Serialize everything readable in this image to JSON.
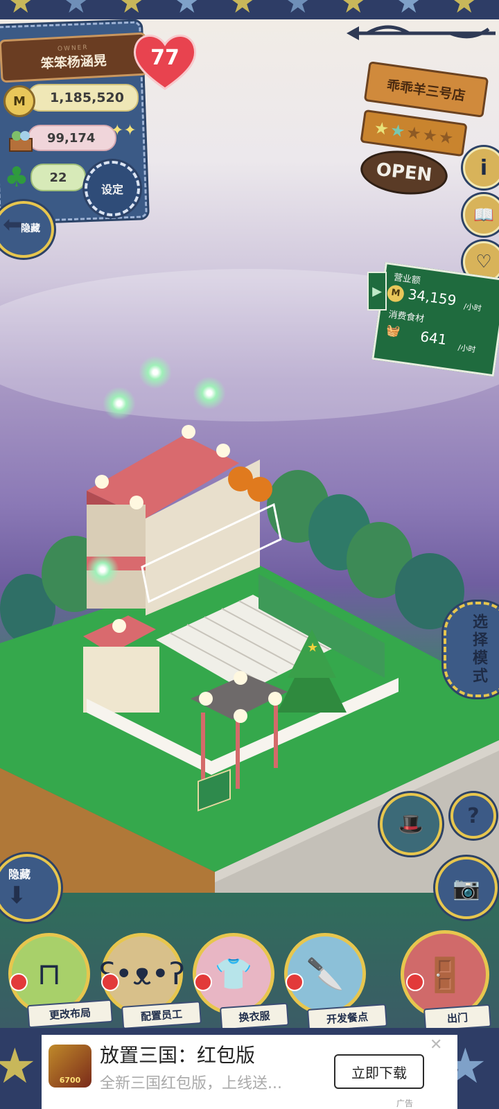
{
  "owner": {
    "badge": "OWNER",
    "name": "笨笨杨涵晃",
    "level": "77"
  },
  "stats": {
    "money": "1,185,520",
    "ingredients": "99,174",
    "clover": "22"
  },
  "buttons": {
    "settings": "设定",
    "hide_top": "隐藏",
    "hide_bottom": "隐藏",
    "select_mode": "选择模式"
  },
  "shop": {
    "name": "乖乖羊三号店",
    "stars_filled": 2,
    "stars_total": 5,
    "open_sign": "OPEN"
  },
  "revenue_panel": {
    "revenue_label": "营业额",
    "revenue_value": "34,159",
    "revenue_unit": "/小时",
    "consume_label": "消费食材",
    "consume_value": "641",
    "consume_unit": "/小时"
  },
  "side_icons": [
    "info-icon",
    "book-icon",
    "heart-icon"
  ],
  "menu": [
    {
      "label": "更改布局",
      "icon": "table-icon"
    },
    {
      "label": "配置员工",
      "icon": "bear-icon"
    },
    {
      "label": "换衣服",
      "icon": "shirt-icon"
    },
    {
      "label": "开发餐点",
      "icon": "knife-icon"
    },
    {
      "label": "出门",
      "icon": "door-icon"
    }
  ],
  "ad": {
    "title": "放置三国：红包版",
    "subtitle": "全新三国红包版，上线送...",
    "button": "立即下载",
    "badge": "广告",
    "icon_text": "6700"
  },
  "colors": {
    "denim": "#3b5a86",
    "gold_border": "#e7c64e",
    "wood": "#c98a3d",
    "sign_green": "#1f6b3e",
    "heart_red": "#e8434f"
  }
}
